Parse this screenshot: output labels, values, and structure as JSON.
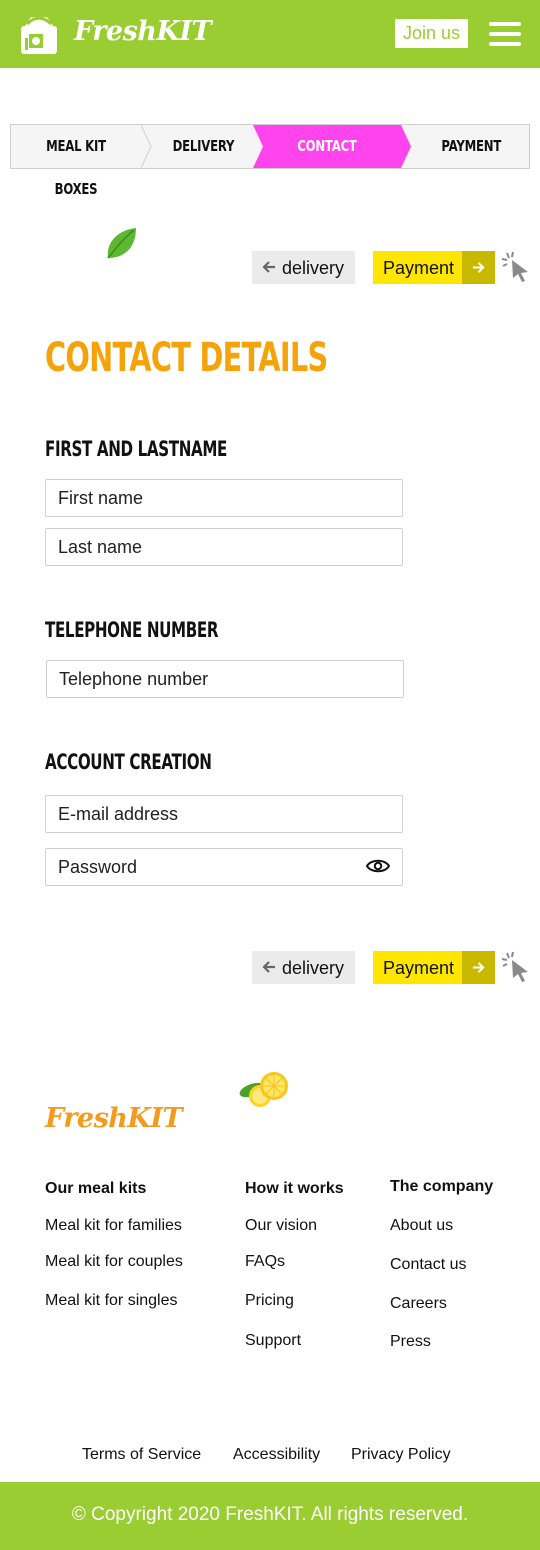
{
  "header": {
    "brand": "FreshKIT",
    "join_label": "Join us",
    "menu_icon": "hamburger-icon",
    "bg_color": "#9acd32"
  },
  "stepper": {
    "steps": [
      "MEAL KIT BOXES",
      "DELIVERY",
      "CONTACT DETAILS",
      "PAYMENT"
    ],
    "active": "CONTACT DETAILS",
    "active_color": "#ff44ee"
  },
  "nav": {
    "back_label": "delivery",
    "next_label": "Payment"
  },
  "form": {
    "title": "CONTACT DETAILS",
    "name_section": "FIRST AND LASTNAME",
    "first_name_placeholder": "First name",
    "last_name_placeholder": "Last name",
    "phone_section": "TELEPHONE NUMBER",
    "phone_placeholder": "Telephone number",
    "account_section": "ACCOUNT CREATION",
    "email_placeholder": "E-mail address",
    "password_placeholder": "Password"
  },
  "footer": {
    "brand": "FreshKIT",
    "columns": [
      {
        "heading": "Our meal kits",
        "links": [
          "Meal kit for families",
          "Meal kit for couples",
          "Meal kit for singles"
        ]
      },
      {
        "heading": "How it works",
        "links": [
          "Our vision",
          "FAQs",
          "Pricing",
          "Support"
        ]
      },
      {
        "heading": "The company",
        "links": [
          "About us",
          "Contact us",
          "Careers",
          "Press"
        ]
      }
    ],
    "legal": [
      "Terms of Service",
      "Accessibility",
      "Privacy Policy"
    ],
    "copyright": "© Copyright 2020 FreshKIT. All rights reserved."
  },
  "colors": {
    "accent_orange": "#f5a30a",
    "button_yellow": "#ffe600",
    "brand_green": "#9acd32"
  }
}
